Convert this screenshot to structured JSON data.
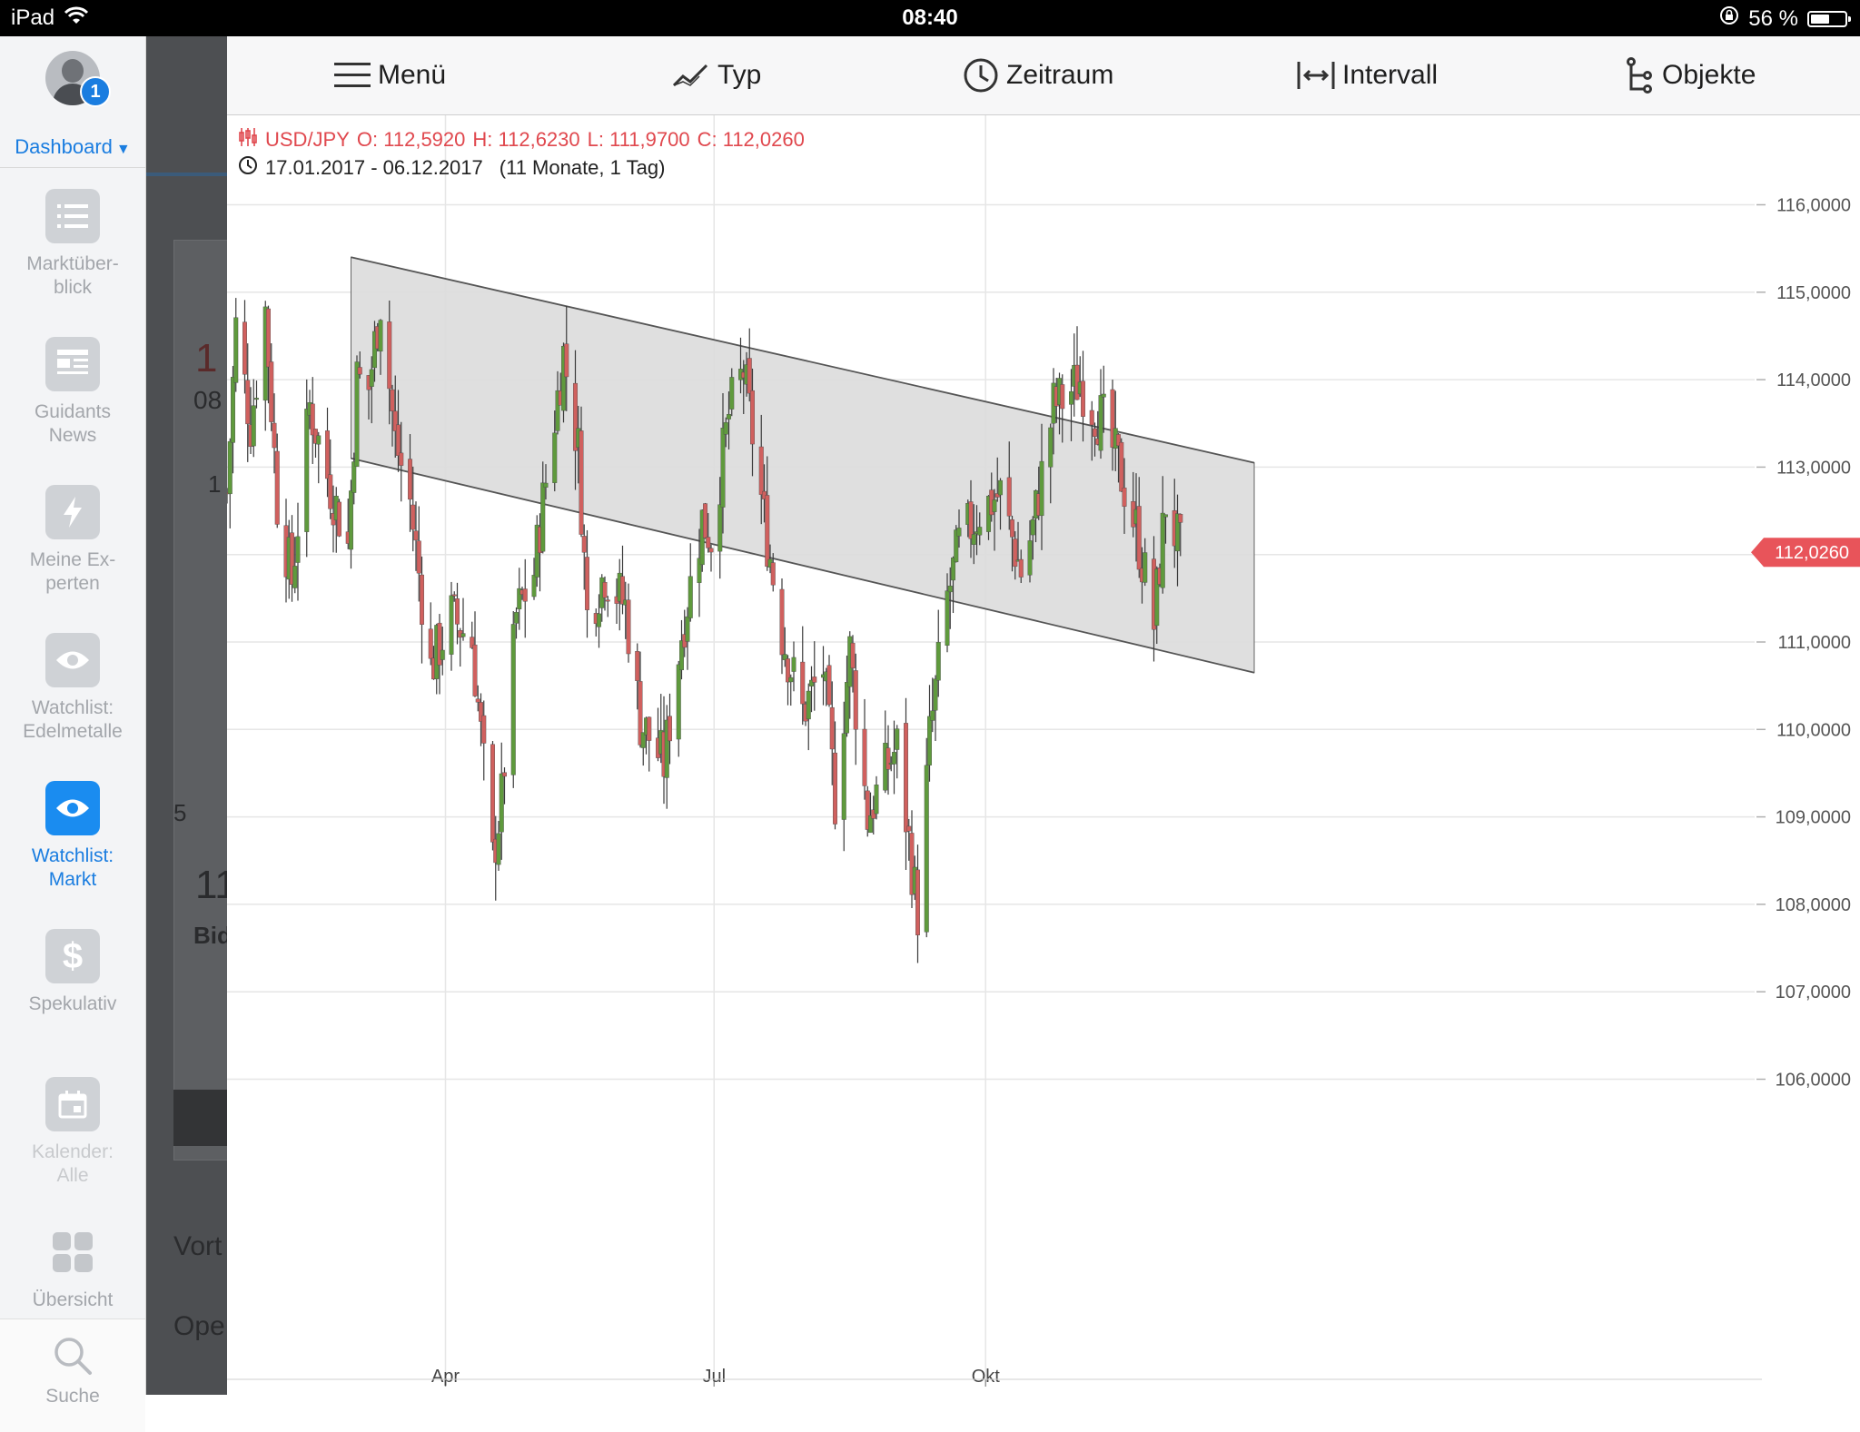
{
  "statusbar": {
    "device": "iPad",
    "time": "08:40",
    "battery_text": "56 %",
    "battery_level": 0.56
  },
  "sidebar": {
    "badge": "1",
    "dashboard_label": "Dashboard",
    "items": [
      {
        "label1": "Marktüber-",
        "label2": "blick",
        "icon": "list-icon"
      },
      {
        "label1": "Guidants",
        "label2": "News",
        "icon": "news-icon"
      },
      {
        "label1": "Meine Ex-",
        "label2": "perten",
        "icon": "lightning-icon"
      },
      {
        "label1": "Watchlist:",
        "label2": "Edelmetalle",
        "icon": "eye-icon"
      },
      {
        "label1": "Watchlist:",
        "label2": "Markt",
        "icon": "eye-icon",
        "active": true
      },
      {
        "label1": "",
        "label2": "Spekulativ",
        "icon": "dollar-icon"
      },
      {
        "label1": "Kalender:",
        "label2": "Alle",
        "icon": "calendar-icon"
      },
      {
        "label1": "",
        "label2": "Übersicht",
        "icon": "grid-icon"
      }
    ],
    "search_label": "Suche"
  },
  "background": {
    "frag1": "1",
    "frag2": "08",
    "frag3": "1",
    "frag4": "11",
    "frag5": "Bid",
    "frag6": "Vort",
    "frag7": "Ope",
    "frag8": "5"
  },
  "toolbar": {
    "menu": "Menü",
    "type": "Typ",
    "period": "Zeitraum",
    "interval": "Intervall",
    "objects": "Objekte"
  },
  "legend": {
    "symbol": "USD/JPY",
    "open": "O: 112,5920",
    "high": "H: 112,6230",
    "low": "L: 111,9700",
    "close": "C: 112,0260",
    "range": "17.01.2017 - 06.12.2017",
    "duration": "(11 Monate, 1 Tag)"
  },
  "colors": {
    "up": "#5f9a3d",
    "down": "#d0605e",
    "accent": "#1a7de0",
    "price_tag": "#e8545a"
  },
  "chart_data": {
    "type": "candlestick",
    "symbol": "USD/JPY",
    "x_range": [
      "2017-01-17",
      "2017-12-06"
    ],
    "y_range": [
      106,
      116
    ],
    "y_ticks": [
      "116,0000",
      "115,0000",
      "114,0000",
      "113,0000",
      "112,0000",
      "111,0000",
      "110,0000",
      "109,0000",
      "108,0000",
      "107,0000",
      "106,0000"
    ],
    "y_tick_values": [
      116,
      115,
      114,
      113,
      112,
      111,
      110,
      109,
      108,
      107,
      106
    ],
    "x_ticks": [
      "Apr",
      "Jul",
      "Okt"
    ],
    "x_tick_dates": [
      "2017-04-01",
      "2017-07-01",
      "2017-10-01"
    ],
    "last_price_label": "112,0260",
    "last_price": 112.026,
    "channel": {
      "upper": [
        {
          "date": "2017-02-28",
          "value": 115.4
        },
        {
          "date": "2017-12-31",
          "value": 113.05
        }
      ],
      "lower": [
        {
          "date": "2017-02-28",
          "value": 113.1
        },
        {
          "date": "2017-12-31",
          "value": 110.65
        }
      ]
    },
    "close_anchors": [
      {
        "date": "2017-01-17",
        "value": 112.7
      },
      {
        "date": "2017-01-20",
        "value": 114.6
      },
      {
        "date": "2017-01-25",
        "value": 113.5
      },
      {
        "date": "2017-01-30",
        "value": 114.8
      },
      {
        "date": "2017-02-03",
        "value": 112.6
      },
      {
        "date": "2017-02-08",
        "value": 111.7
      },
      {
        "date": "2017-02-14",
        "value": 113.7
      },
      {
        "date": "2017-02-20",
        "value": 112.9
      },
      {
        "date": "2017-02-27",
        "value": 112.1
      },
      {
        "date": "2017-03-02",
        "value": 114.0
      },
      {
        "date": "2017-03-06",
        "value": 113.9
      },
      {
        "date": "2017-03-10",
        "value": 114.9
      },
      {
        "date": "2017-03-15",
        "value": 113.3
      },
      {
        "date": "2017-03-20",
        "value": 112.6
      },
      {
        "date": "2017-03-27",
        "value": 110.7
      },
      {
        "date": "2017-04-03",
        "value": 111.3
      },
      {
        "date": "2017-04-10",
        "value": 111.0
      },
      {
        "date": "2017-04-17",
        "value": 108.5
      },
      {
        "date": "2017-04-20",
        "value": 109.2
      },
      {
        "date": "2017-04-25",
        "value": 111.3
      },
      {
        "date": "2017-05-01",
        "value": 111.8
      },
      {
        "date": "2017-05-04",
        "value": 112.6
      },
      {
        "date": "2017-05-11",
        "value": 114.3
      },
      {
        "date": "2017-05-16",
        "value": 113.2
      },
      {
        "date": "2017-05-19",
        "value": 111.3
      },
      {
        "date": "2017-05-25",
        "value": 111.8
      },
      {
        "date": "2017-06-01",
        "value": 111.4
      },
      {
        "date": "2017-06-06",
        "value": 110.1
      },
      {
        "date": "2017-06-14",
        "value": 109.6
      },
      {
        "date": "2017-06-20",
        "value": 111.1
      },
      {
        "date": "2017-06-27",
        "value": 112.4
      },
      {
        "date": "2017-06-30",
        "value": 112.2
      },
      {
        "date": "2017-07-06",
        "value": 113.6
      },
      {
        "date": "2017-07-11",
        "value": 114.1
      },
      {
        "date": "2017-07-18",
        "value": 112.4
      },
      {
        "date": "2017-07-24",
        "value": 111.1
      },
      {
        "date": "2017-07-31",
        "value": 110.2
      },
      {
        "date": "2017-08-07",
        "value": 110.7
      },
      {
        "date": "2017-08-11",
        "value": 109.2
      },
      {
        "date": "2017-08-16",
        "value": 110.9
      },
      {
        "date": "2017-08-22",
        "value": 109.0
      },
      {
        "date": "2017-08-29",
        "value": 109.6
      },
      {
        "date": "2017-09-01",
        "value": 109.8
      },
      {
        "date": "2017-09-08",
        "value": 107.9
      },
      {
        "date": "2017-09-12",
        "value": 109.9
      },
      {
        "date": "2017-09-18",
        "value": 111.5
      },
      {
        "date": "2017-09-22",
        "value": 112.1
      },
      {
        "date": "2017-09-29",
        "value": 112.5
      },
      {
        "date": "2017-10-06",
        "value": 112.7
      },
      {
        "date": "2017-10-13",
        "value": 111.8
      },
      {
        "date": "2017-10-17",
        "value": 112.3
      },
      {
        "date": "2017-10-24",
        "value": 113.7
      },
      {
        "date": "2017-10-28",
        "value": 113.8
      },
      {
        "date": "2017-11-02",
        "value": 114.0
      },
      {
        "date": "2017-11-06",
        "value": 113.7
      },
      {
        "date": "2017-11-10",
        "value": 113.5
      },
      {
        "date": "2017-11-16",
        "value": 112.9
      },
      {
        "date": "2017-11-21",
        "value": 112.3
      },
      {
        "date": "2017-11-27",
        "value": 111.2
      },
      {
        "date": "2017-12-01",
        "value": 112.6
      },
      {
        "date": "2017-12-06",
        "value": 112.03
      }
    ]
  }
}
